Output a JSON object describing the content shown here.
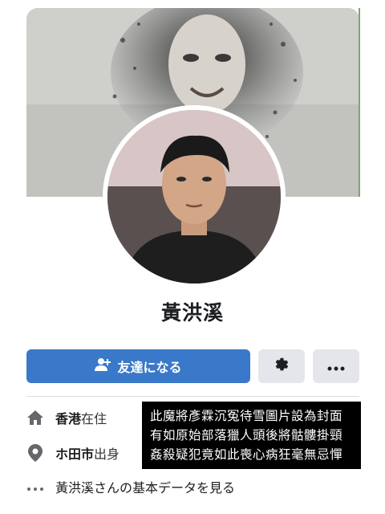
{
  "profile": {
    "name": "黃洪溪"
  },
  "actions": {
    "add_friend_label": "友達になる",
    "add_friend_icon": "person-add-icon",
    "settings_icon": "gear-icon",
    "more_icon": "ellipsis-icon"
  },
  "details": {
    "lives_in_place": "香港",
    "lives_in_suffix": "在住",
    "from_place": "ホ田市",
    "from_suffix": "出身",
    "see_more": "黃洪溪さんの基本データを見る"
  },
  "caption": {
    "lines": [
      "此魔將彥霖沉冤待雪圖片設為封面",
      "有如原始部落獵人頭後將骷髏掛頸",
      "姦殺疑犯竟如此喪心病狂毫無忌憚"
    ]
  },
  "colors": {
    "primary": "#3a78c9",
    "button_gray": "#e4e6eb",
    "caption_bg": "#000000"
  }
}
